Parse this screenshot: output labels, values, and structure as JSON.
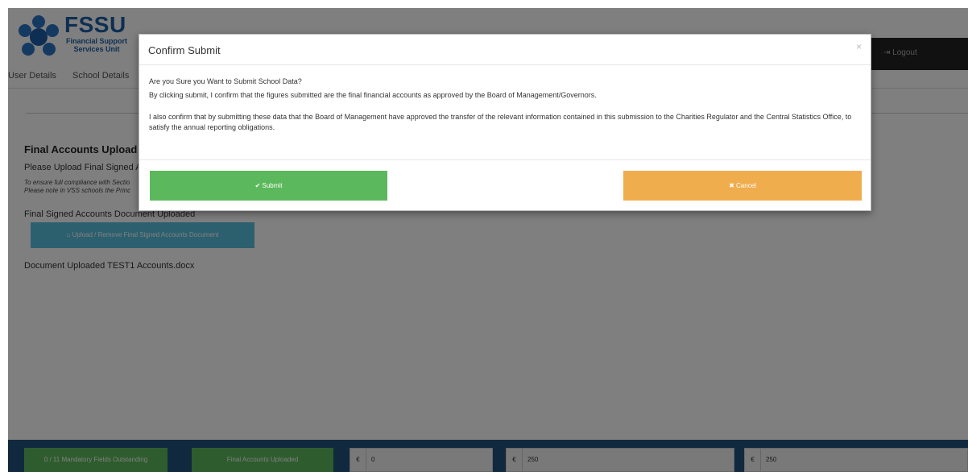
{
  "app": {
    "logo_text": "FSSU",
    "logo_sub_line1": "Financial Support",
    "logo_sub_line2": "Services Unit"
  },
  "header": {
    "logout_label": "Logout"
  },
  "nav": {
    "items": [
      "User Details",
      "School Details"
    ]
  },
  "page": {
    "title": "Final Accounts Upload",
    "upload_prompt": "Please Upload Final Signed Ac",
    "note_line1": "To ensure full compliance with Sectio",
    "note_line2": "Please note in VSS schools the Princ",
    "uploaded_label": "Final Signed Accounts Document Uploaded",
    "upload_button": "Upload / Remove Final Signed Accounts Document",
    "document_line": "Document Uploaded TEST1 Accounts.docx"
  },
  "footer": {
    "mandatory_button": "0 / 11 Mandatory Fields Outstanding",
    "accounts_button": "Final Accounts Uploaded",
    "currency_symbol": "€",
    "box1_value": "0",
    "box2_value": "250",
    "box3_value": "250"
  },
  "modal": {
    "title": "Confirm Submit",
    "close_glyph": "×",
    "question": "Are you Sure you Want to Submit School Data?",
    "confirm_text": "By clicking submit, I confirm that the figures submitted are the final financial accounts as approved by the Board of Management/Governors.",
    "transfer_text": "I also confirm that by submitting these data that the Board of Management have approved the transfer of the relevant information contained in this submission to the Charities Regulator and the Central Statistics Office, to satisfy the annual reporting obligations.",
    "submit_label": "Submit",
    "cancel_label": "Cancel"
  },
  "colors": {
    "success": "#5cb85c",
    "warning": "#f0ad4e",
    "info": "#5bc0de",
    "footer_bg": "#23527c",
    "brand": "#1d5fa6"
  }
}
